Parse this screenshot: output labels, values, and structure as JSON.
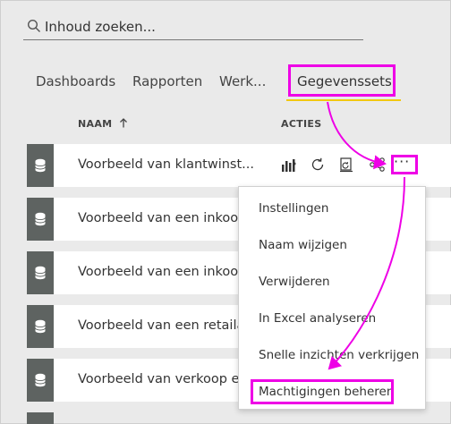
{
  "search": {
    "placeholder": "Inhoud zoeken..."
  },
  "tabs": [
    {
      "label": "Dashboards"
    },
    {
      "label": "Rapporten"
    },
    {
      "label": "Werk..."
    },
    {
      "label": "Gegevenssets",
      "active": true
    }
  ],
  "columns": {
    "name": "NAAM",
    "sort_icon": "arrow-up-icon",
    "actions": "ACTIES"
  },
  "rows": [
    {
      "name": "Voorbeeld van klantwinst..."
    },
    {
      "name": "Voorbeeld van een inkoop"
    },
    {
      "name": "Voorbeeld van een inkoop"
    },
    {
      "name": "Voorbeeld van een retaila"
    },
    {
      "name": "Voorbeeld van verkoop en"
    }
  ],
  "actions_icons": [
    "analyze-icon",
    "refresh-icon",
    "schedule-refresh-icon",
    "related-content-icon",
    "more-options-icon"
  ],
  "more_label": "···",
  "menu": {
    "items": [
      "Instellingen",
      "Naam wijzigen",
      "Verwijderen",
      "In Excel analyseren",
      "Snelle inzichten verkrijgen",
      "Machtigingen beheren"
    ]
  },
  "colors": {
    "highlight": "#ee00e6",
    "tab_underline": "#f2c811",
    "tile": "#5e6361"
  }
}
